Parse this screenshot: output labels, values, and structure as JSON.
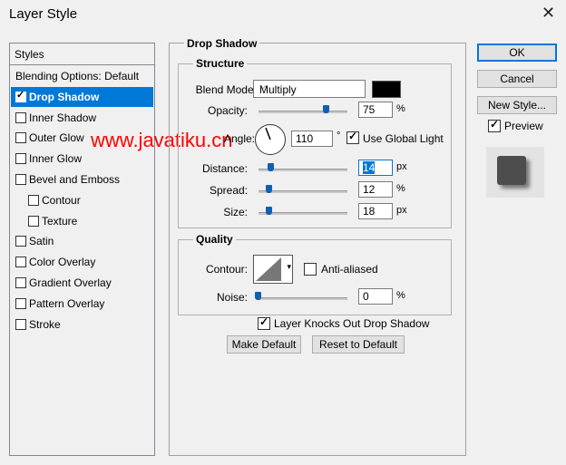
{
  "window": {
    "title": "Layer Style",
    "close_glyph": "✕"
  },
  "styles_list": {
    "header": "Styles",
    "items": [
      {
        "label": "Blending Options: Default",
        "checkbox": false,
        "checked": false,
        "selected": false,
        "indent": 0
      },
      {
        "label": "Drop Shadow",
        "checkbox": true,
        "checked": true,
        "selected": true,
        "indent": 0
      },
      {
        "label": "Inner Shadow",
        "checkbox": true,
        "checked": false,
        "selected": false,
        "indent": 0
      },
      {
        "label": "Outer Glow",
        "checkbox": true,
        "checked": false,
        "selected": false,
        "indent": 0
      },
      {
        "label": "Inner Glow",
        "checkbox": true,
        "checked": false,
        "selected": false,
        "indent": 0
      },
      {
        "label": "Bevel and Emboss",
        "checkbox": true,
        "checked": false,
        "selected": false,
        "indent": 0
      },
      {
        "label": "Contour",
        "checkbox": true,
        "checked": false,
        "selected": false,
        "indent": 1
      },
      {
        "label": "Texture",
        "checkbox": true,
        "checked": false,
        "selected": false,
        "indent": 1
      },
      {
        "label": "Satin",
        "checkbox": true,
        "checked": false,
        "selected": false,
        "indent": 0
      },
      {
        "label": "Color Overlay",
        "checkbox": true,
        "checked": false,
        "selected": false,
        "indent": 0
      },
      {
        "label": "Gradient Overlay",
        "checkbox": true,
        "checked": false,
        "selected": false,
        "indent": 0
      },
      {
        "label": "Pattern Overlay",
        "checkbox": true,
        "checked": false,
        "selected": false,
        "indent": 0
      },
      {
        "label": "Stroke",
        "checkbox": true,
        "checked": false,
        "selected": false,
        "indent": 0
      }
    ]
  },
  "watermark": "www.javatiku.cn",
  "drop_shadow": {
    "title": "Drop Shadow",
    "structure": {
      "title": "Structure",
      "blend_mode_label": "Blend Mode:",
      "blend_mode_value": "Multiply",
      "shadow_color": "#000000",
      "opacity_label": "Opacity:",
      "opacity_value": "75",
      "opacity_unit": "%",
      "opacity_level": 0.75,
      "angle_label": "Angle:",
      "angle_value": "110",
      "angle_unit": "°",
      "global_light_label": "Use Global Light",
      "global_light_checked": true,
      "distance_label": "Distance:",
      "distance_value": "14",
      "distance_unit": "px",
      "spread_label": "Spread:",
      "spread_value": "12",
      "spread_unit": "%",
      "size_label": "Size:",
      "size_value": "18",
      "size_unit": "px"
    },
    "quality": {
      "title": "Quality",
      "contour_label": "Contour:",
      "anti_aliased_label": "Anti-aliased",
      "anti_aliased_checked": false,
      "noise_label": "Noise:",
      "noise_value": "0",
      "noise_unit": "%"
    },
    "knocks_out_label": "Layer Knocks Out Drop Shadow",
    "knocks_out_checked": true,
    "make_default_label": "Make Default",
    "reset_default_label": "Reset to Default"
  },
  "buttons": {
    "ok": "OK",
    "cancel": "Cancel",
    "new_style": "New Style...",
    "preview_label": "Preview",
    "preview_checked": true
  },
  "colors": {
    "selection": "#0078d7",
    "slider_thumb": "#1060b0",
    "watermark": "#ff0000"
  }
}
